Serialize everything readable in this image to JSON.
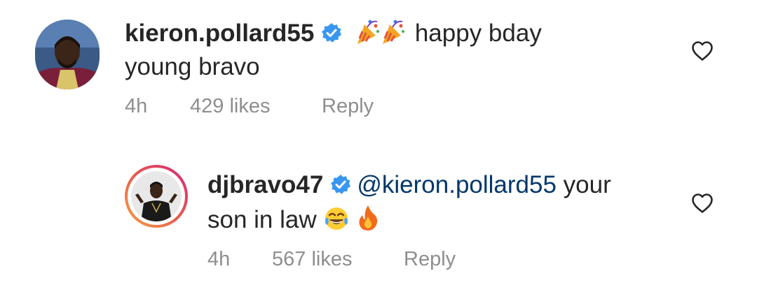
{
  "comments": [
    {
      "username": "kieron.pollard55",
      "text_line1": "happy bday",
      "text_line2": "young bravo",
      "time": "4h",
      "likes": "429 likes",
      "reply": "Reply",
      "icons": [
        "verified-badge-icon",
        "party-popper-emoji",
        "party-popper-emoji",
        "heart-outline-icon"
      ]
    },
    {
      "username": "djbravo47",
      "mention": "@kieron.pollard55",
      "text_line1": " your",
      "text_line2": "son in law",
      "time": "4h",
      "likes": "567 likes",
      "reply": "Reply",
      "icons": [
        "verified-badge-icon",
        "face-with-tears-of-joy-emoji",
        "fire-emoji",
        "heart-outline-icon"
      ]
    }
  ],
  "colors": {
    "text": "#262626",
    "meta": "#8e8e8e",
    "mention": "#00376b",
    "verified": "#3897f0",
    "story_ring_start": "#f9a03f",
    "story_ring_end": "#d62976"
  }
}
